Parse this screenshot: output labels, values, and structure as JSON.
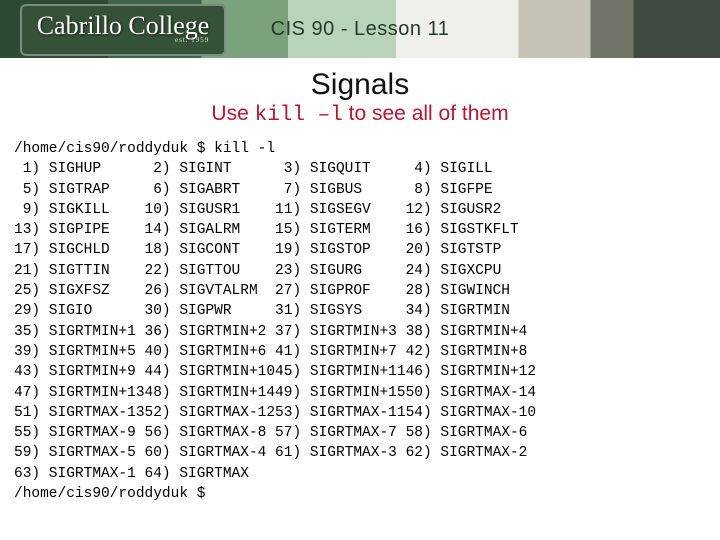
{
  "header": {
    "logo_top": "Cabrillo College",
    "logo_sub": "est. 1959",
    "lesson": "CIS 90 - Lesson 11"
  },
  "title": "Signals",
  "subtitle_pre": "Use ",
  "subtitle_cmd": "kill –l",
  "subtitle_post": " to see all of them",
  "prompt1": "/home/cis90/roddyduk $ kill -l",
  "prompt2": "/home/cis90/roddyduk $",
  "signals": [
    {
      "n": 1,
      "s": "SIGHUP"
    },
    {
      "n": 2,
      "s": "SIGINT"
    },
    {
      "n": 3,
      "s": "SIGQUIT"
    },
    {
      "n": 4,
      "s": "SIGILL"
    },
    {
      "n": 5,
      "s": "SIGTRAP"
    },
    {
      "n": 6,
      "s": "SIGABRT"
    },
    {
      "n": 7,
      "s": "SIGBUS"
    },
    {
      "n": 8,
      "s": "SIGFPE"
    },
    {
      "n": 9,
      "s": "SIGKILL"
    },
    {
      "n": 10,
      "s": "SIGUSR1"
    },
    {
      "n": 11,
      "s": "SIGSEGV"
    },
    {
      "n": 12,
      "s": "SIGUSR2"
    },
    {
      "n": 13,
      "s": "SIGPIPE"
    },
    {
      "n": 14,
      "s": "SIGALRM"
    },
    {
      "n": 15,
      "s": "SIGTERM"
    },
    {
      "n": 16,
      "s": "SIGSTKFLT"
    },
    {
      "n": 17,
      "s": "SIGCHLD"
    },
    {
      "n": 18,
      "s": "SIGCONT"
    },
    {
      "n": 19,
      "s": "SIGSTOP"
    },
    {
      "n": 20,
      "s": "SIGTSTP"
    },
    {
      "n": 21,
      "s": "SIGTTIN"
    },
    {
      "n": 22,
      "s": "SIGTTOU"
    },
    {
      "n": 23,
      "s": "SIGURG"
    },
    {
      "n": 24,
      "s": "SIGXCPU"
    },
    {
      "n": 25,
      "s": "SIGXFSZ"
    },
    {
      "n": 26,
      "s": "SIGVTALRM"
    },
    {
      "n": 27,
      "s": "SIGPROF"
    },
    {
      "n": 28,
      "s": "SIGWINCH"
    },
    {
      "n": 29,
      "s": "SIGIO"
    },
    {
      "n": 30,
      "s": "SIGPWR"
    },
    {
      "n": 31,
      "s": "SIGSYS"
    },
    {
      "n": 34,
      "s": "SIGRTMIN"
    },
    {
      "n": 35,
      "s": "SIGRTMIN+1"
    },
    {
      "n": 36,
      "s": "SIGRTMIN+2"
    },
    {
      "n": 37,
      "s": "SIGRTMIN+3"
    },
    {
      "n": 38,
      "s": "SIGRTMIN+4"
    },
    {
      "n": 39,
      "s": "SIGRTMIN+5"
    },
    {
      "n": 40,
      "s": "SIGRTMIN+6"
    },
    {
      "n": 41,
      "s": "SIGRTMIN+7"
    },
    {
      "n": 42,
      "s": "SIGRTMIN+8"
    },
    {
      "n": 43,
      "s": "SIGRTMIN+9"
    },
    {
      "n": 44,
      "s": "SIGRTMIN+10"
    },
    {
      "n": 45,
      "s": "SIGRTMIN+11"
    },
    {
      "n": 46,
      "s": "SIGRTMIN+12"
    },
    {
      "n": 47,
      "s": "SIGRTMIN+13"
    },
    {
      "n": 48,
      "s": "SIGRTMIN+14"
    },
    {
      "n": 49,
      "s": "SIGRTMIN+15"
    },
    {
      "n": 50,
      "s": "SIGRTMAX-14"
    },
    {
      "n": 51,
      "s": "SIGRTMAX-13"
    },
    {
      "n": 52,
      "s": "SIGRTMAX-12"
    },
    {
      "n": 53,
      "s": "SIGRTMAX-11"
    },
    {
      "n": 54,
      "s": "SIGRTMAX-10"
    },
    {
      "n": 55,
      "s": "SIGRTMAX-9"
    },
    {
      "n": 56,
      "s": "SIGRTMAX-8"
    },
    {
      "n": 57,
      "s": "SIGRTMAX-7"
    },
    {
      "n": 58,
      "s": "SIGRTMAX-6"
    },
    {
      "n": 59,
      "s": "SIGRTMAX-5"
    },
    {
      "n": 60,
      "s": "SIGRTMAX-4"
    },
    {
      "n": 61,
      "s": "SIGRTMAX-3"
    },
    {
      "n": 62,
      "s": "SIGRTMAX-2"
    },
    {
      "n": 63,
      "s": "SIGRTMAX-1"
    },
    {
      "n": 64,
      "s": "SIGRTMAX"
    }
  ]
}
